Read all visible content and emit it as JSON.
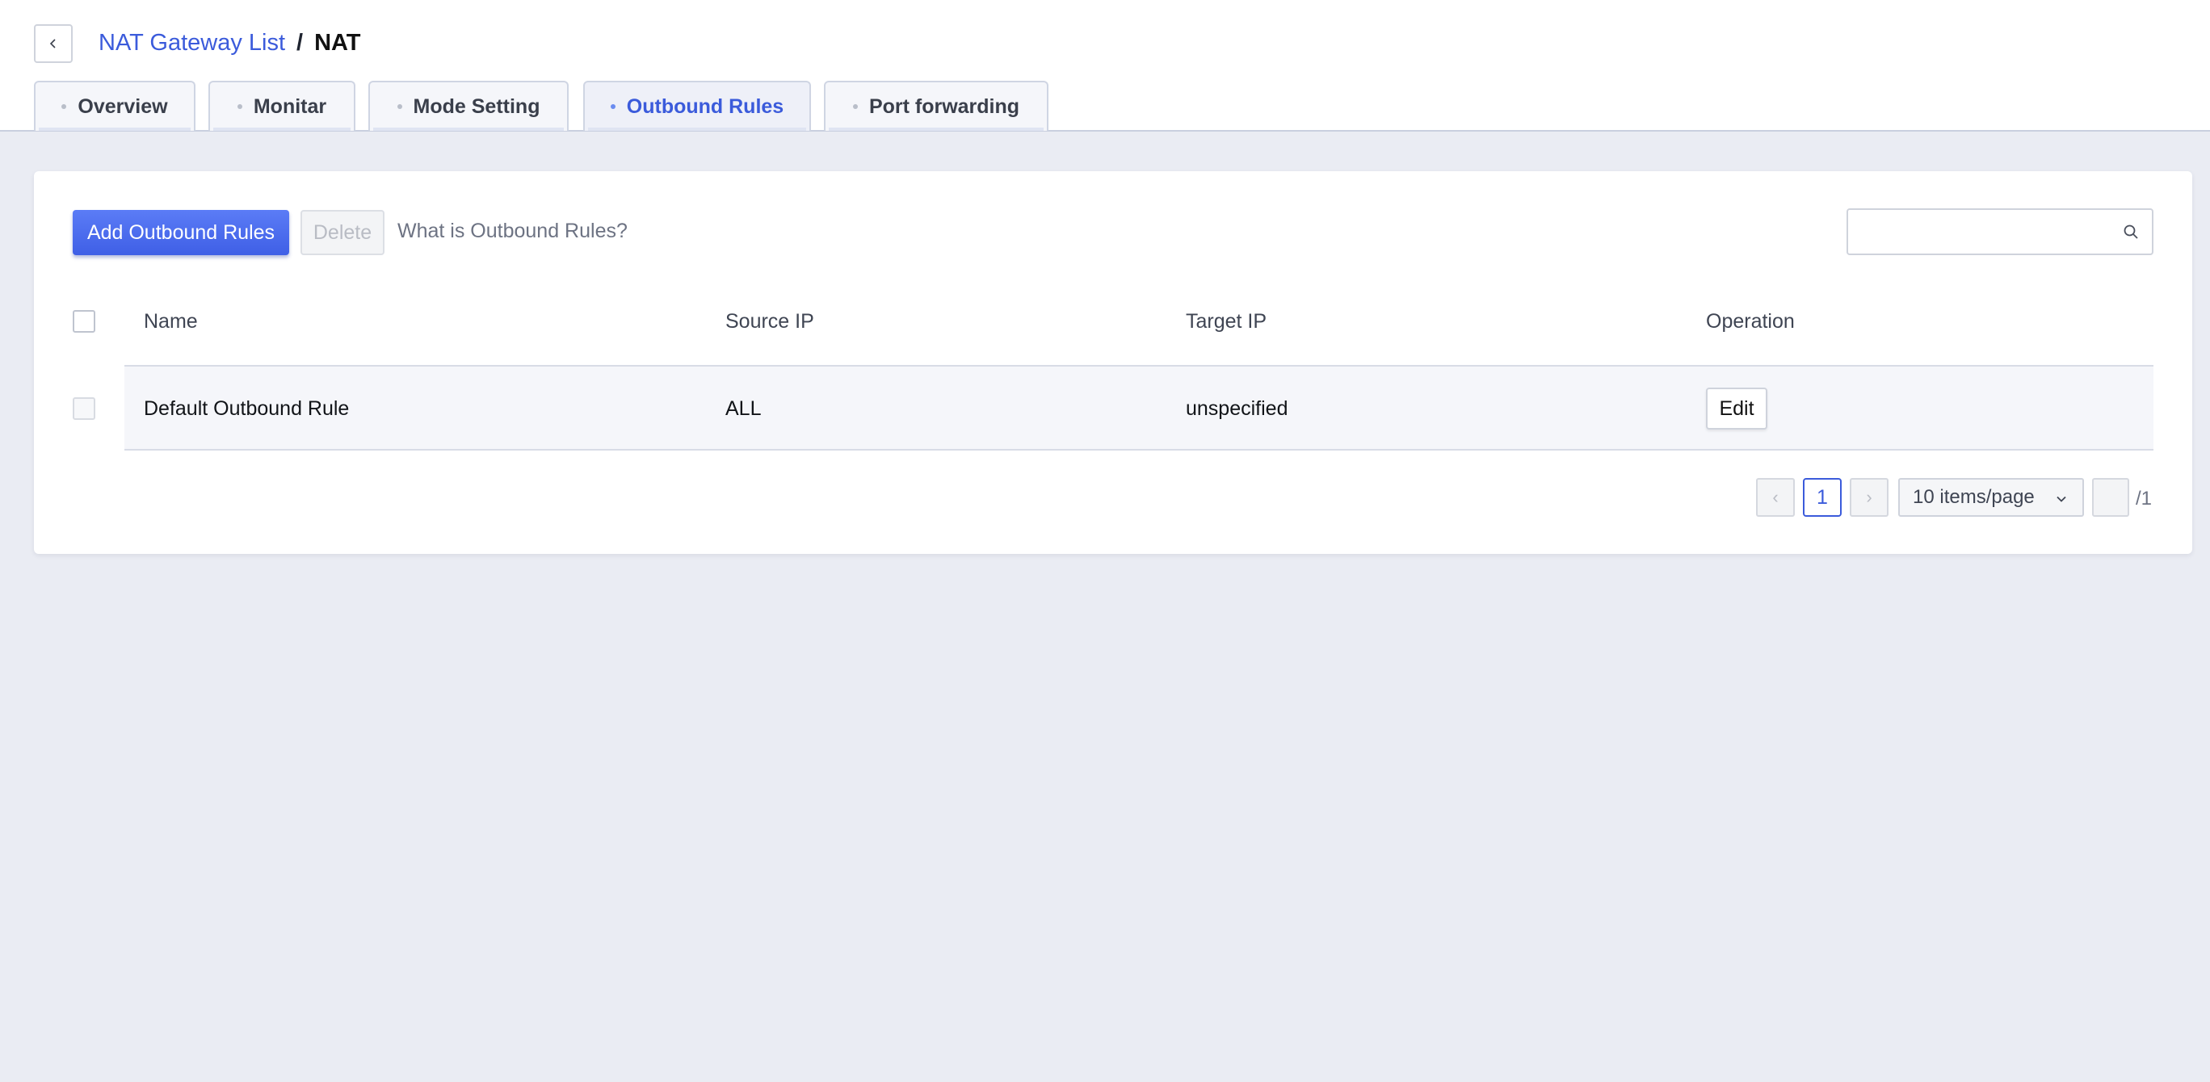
{
  "breadcrumb": {
    "parent": "NAT Gateway List",
    "separator": "/",
    "current": "NAT"
  },
  "tabs": [
    {
      "label": "Overview",
      "active": false
    },
    {
      "label": "Monitar",
      "active": false
    },
    {
      "label": "Mode Setting",
      "active": false
    },
    {
      "label": "Outbound Rules",
      "active": true
    },
    {
      "label": "Port forwarding",
      "active": false
    }
  ],
  "toolbar": {
    "add_label": "Add Outbound Rules",
    "delete_label": "Delete",
    "help_link": "What is Outbound Rules?",
    "search_placeholder": ""
  },
  "table": {
    "columns": [
      "Name",
      "Source IP",
      "Target IP",
      "Operation"
    ],
    "rows": [
      {
        "name": "Default Outbound Rule",
        "source_ip": "ALL",
        "target_ip": "unspecified",
        "operation": "Edit"
      }
    ]
  },
  "pagination": {
    "prev": "‹",
    "current_page": "1",
    "next": "›",
    "page_size": "10 items/page",
    "total_pages": "/1"
  },
  "colors": {
    "accent": "#3b5bdb",
    "background": "#eaecf3",
    "card": "#ffffff"
  }
}
